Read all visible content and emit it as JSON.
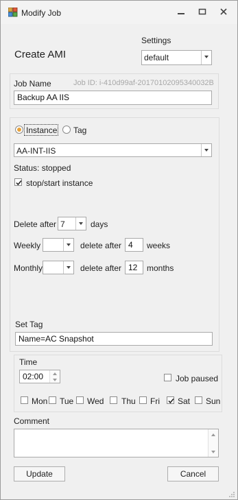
{
  "window": {
    "title": "Modify Job"
  },
  "header": {
    "heading": "Create AMI",
    "settings_label": "Settings",
    "settings_value": "default"
  },
  "job": {
    "name_label": "Job Name",
    "job_id": "Job ID: i-410d99af-20170102095340032B",
    "name_value": "Backup AA IIS"
  },
  "target": {
    "instance_label": "Instance",
    "tag_label": "Tag",
    "selected": "instance",
    "instance_value": "AA-INT-IIS",
    "status": "Status: stopped",
    "stopstart_label": "stop/start instance",
    "stopstart_checked": true
  },
  "retention": {
    "delete_after_label": "Delete after",
    "delete_after_value": "7",
    "days_label": "days",
    "weekly_label": "Weekly",
    "weekly_value": "",
    "weekly_delete_label": "delete after",
    "weekly_delete_value": "4",
    "weeks_label": "weeks",
    "monthly_label": "Monthly",
    "monthly_value": "",
    "monthly_delete_label": "delete after",
    "monthly_delete_value": "12",
    "months_label": "months"
  },
  "tag": {
    "set_tag_label": "Set Tag",
    "value": "Name=AC Snapshot"
  },
  "schedule": {
    "time_label": "Time",
    "time_value": "02:00",
    "paused_label": "Job paused",
    "paused": false,
    "days": [
      {
        "label": "Mon",
        "checked": false
      },
      {
        "label": "Tue",
        "checked": false
      },
      {
        "label": "Wed",
        "checked": false
      },
      {
        "label": "Thu",
        "checked": false
      },
      {
        "label": "Fri",
        "checked": false
      },
      {
        "label": "Sat",
        "checked": true
      },
      {
        "label": "Sun",
        "checked": false
      }
    ]
  },
  "comment": {
    "label": "Comment",
    "value": ""
  },
  "buttons": {
    "update": "Update",
    "cancel": "Cancel"
  },
  "colors": {
    "radio_accent": "#e8a23a",
    "id_text": "#a8a8a8"
  }
}
